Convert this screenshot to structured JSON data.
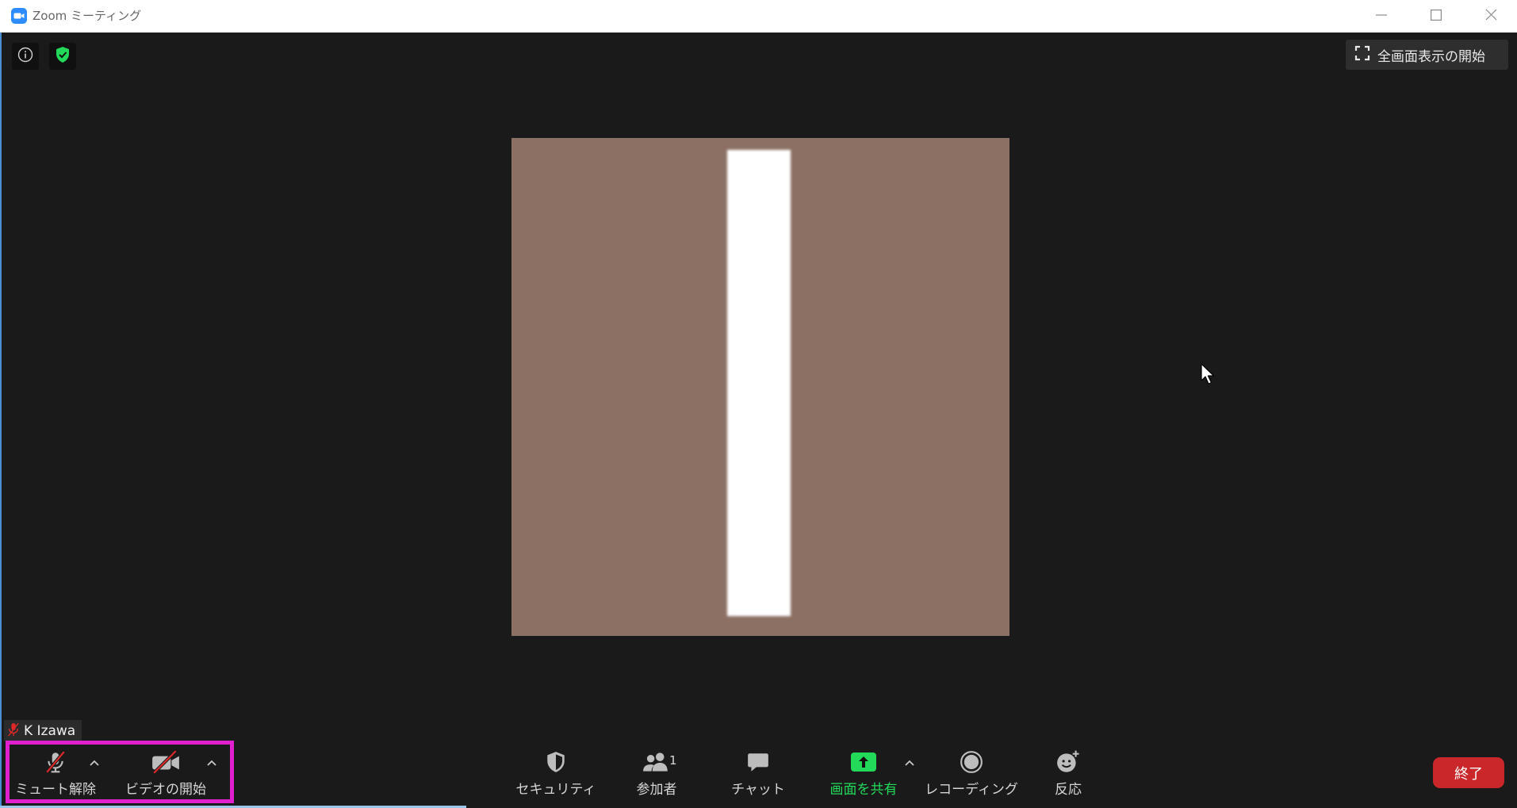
{
  "window": {
    "title": "Zoom ミーティング",
    "app_icon": "zoom-logo-icon",
    "controls": [
      "minimize-icon",
      "maximize-icon",
      "close-icon"
    ]
  },
  "meeting_info": {
    "info_icon": "info-icon",
    "encryption_icon": "shield-check-icon"
  },
  "fullscreen": {
    "label": "全画面表示の開始",
    "icon": "fullscreen-icon"
  },
  "video_tile": {
    "participant_name": "K Izawa",
    "audio_muted": true,
    "status_icon": "microphone-muted-icon"
  },
  "toolbar": {
    "mute": {
      "label": "ミュート解除",
      "icon": "microphone-muted-icon"
    },
    "video": {
      "label": "ビデオの開始",
      "icon": "video-off-icon"
    },
    "security": {
      "label": "セキュリティ",
      "icon": "shield-icon"
    },
    "participants": {
      "label": "参加者",
      "count": "1",
      "icon": "participants-icon"
    },
    "chat": {
      "label": "チャット",
      "icon": "chat-icon"
    },
    "share": {
      "label": "画面を共有",
      "icon": "share-screen-icon"
    },
    "record": {
      "label": "レコーディング",
      "icon": "record-icon"
    },
    "reactions": {
      "label": "反応",
      "icon": "reactions-icon"
    },
    "end": {
      "label": "終了"
    }
  },
  "colors": {
    "brand_blue": "#2d8cff",
    "share_green": "#23d959",
    "end_red": "#c9272a",
    "mute_red": "#e02828",
    "highlight_magenta": "#e020cf",
    "video_background": "#8d7064"
  }
}
